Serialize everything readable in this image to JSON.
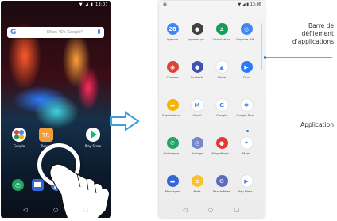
{
  "left_phone": {
    "status_time": "13:07",
    "search_placeholder": "Dites \"Ok Google\"",
    "google_logo": "G",
    "home_apps": [
      {
        "label": "Google",
        "color": "#ffffff",
        "icon": "google-folder-icon"
      },
      {
        "label": "Tommy",
        "color": "#f39c3a",
        "icon": "tommy-icon"
      },
      {
        "label": "Play Store",
        "color": "#ffffff",
        "icon": "play-store-icon"
      }
    ],
    "dock": [
      {
        "name": "phone",
        "color": "#1fa463",
        "icon": "phone-icon"
      },
      {
        "name": "messages",
        "color": "#3367d6",
        "icon": "messages-icon"
      },
      {
        "name": "contacts",
        "color": "#4285f4",
        "icon": "contacts-icon"
      },
      {
        "name": "chrome",
        "color": "#db4437",
        "icon": "chrome-icon"
      }
    ],
    "nav": [
      "◁",
      "○",
      "□"
    ]
  },
  "right_phone": {
    "status_time": "13:08",
    "apps": [
      {
        "label": "Agenda",
        "color": "#4285f4",
        "glyph": "28"
      },
      {
        "label": "Appareil ph...",
        "color": "#424242",
        "glyph": "●"
      },
      {
        "label": "Calculatrice",
        "color": "#0f9d58",
        "glyph": "±"
      },
      {
        "label": "Capture d'é...",
        "color": "#4285f4",
        "glyph": "◎"
      },
      {
        "label": "Chrome",
        "color": "#db4437",
        "glyph": "◉"
      },
      {
        "label": "Contacts",
        "color": "#3f51b5",
        "glyph": "●"
      },
      {
        "label": "Drive",
        "color": "#ffffff",
        "glyph": "▲"
      },
      {
        "label": "Duo",
        "color": "#2979ff",
        "glyph": "▶"
      },
      {
        "label": "Explorateur...",
        "color": "#f4b400",
        "glyph": "▬"
      },
      {
        "label": "Gmail",
        "color": "#ffffff",
        "glyph": "M"
      },
      {
        "label": "Google",
        "color": "#ffffff",
        "glyph": "G"
      },
      {
        "label": "Google Pho...",
        "color": "#ffffff",
        "glyph": "✱"
      },
      {
        "label": "Historique...",
        "color": "#1fa463",
        "glyph": "✆"
      },
      {
        "label": "Horloge",
        "color": "#7986cb",
        "glyph": "◷"
      },
      {
        "label": "Magnétoph...",
        "color": "#e53935",
        "glyph": "●"
      },
      {
        "label": "Maps",
        "color": "#ffffff",
        "glyph": "⌖"
      },
      {
        "label": "Messages",
        "color": "#3367d6",
        "glyph": "▬"
      },
      {
        "label": "Note",
        "color": "#fbc02d",
        "glyph": "≡"
      },
      {
        "label": "Paramètres",
        "color": "#5c6bc0",
        "glyph": "⚙"
      },
      {
        "label": "Play Films...",
        "color": "#ffffff",
        "glyph": "▶"
      }
    ],
    "nav": [
      "◁",
      "○",
      "□"
    ]
  },
  "annotations": {
    "scrollbar": [
      "Barre de",
      "défilement",
      "d'applications"
    ],
    "app": "Application"
  }
}
